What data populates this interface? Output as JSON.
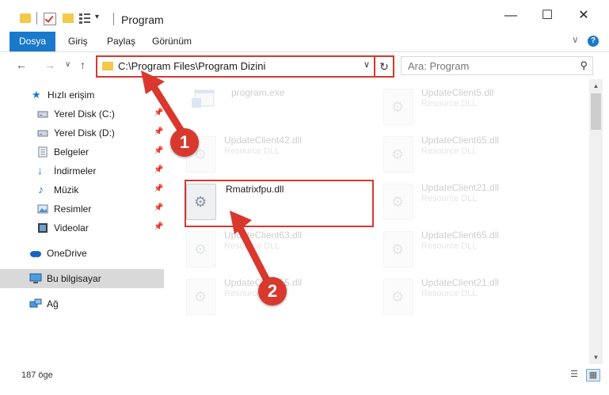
{
  "window": {
    "title": "Program",
    "minimize": "—",
    "maximize": "☐",
    "close": "✕"
  },
  "quick_access_toolbar": {
    "dropdown": "▾"
  },
  "ribbon": {
    "tabs": [
      "Dosya",
      "Giriş",
      "Paylaş",
      "Görünüm"
    ],
    "expand": "∨",
    "help": "?"
  },
  "navigation": {
    "back": "←",
    "forward": "→",
    "recent": "∨",
    "up": "↑",
    "address": "C:\\Program Files\\Program Dizini",
    "address_dropdown": "∨",
    "refresh": "↻",
    "search_placeholder": "Ara: Program",
    "search_icon": "⚲"
  },
  "sidebar": {
    "items": [
      {
        "label": "Hızlı erişim",
        "icon": "star-icon",
        "pinned": false
      },
      {
        "label": "Yerel Disk (C:)",
        "icon": "drive-icon",
        "pinned": true
      },
      {
        "label": "Yerel Disk (D:)",
        "icon": "drive-icon",
        "pinned": true
      },
      {
        "label": "Belgeler",
        "icon": "documents-icon",
        "pinned": true
      },
      {
        "label": "İndirmeler",
        "icon": "download-icon",
        "pinned": true
      },
      {
        "label": "Müzik",
        "icon": "music-icon",
        "pinned": true
      },
      {
        "label": "Resimler",
        "icon": "pictures-icon",
        "pinned": true
      },
      {
        "label": "Videolar",
        "icon": "video-icon",
        "pinned": true
      },
      {
        "label": "OneDrive",
        "icon": "cloud-icon",
        "pinned": false
      },
      {
        "label": "Bu bilgisayar",
        "icon": "computer-icon",
        "pinned": false,
        "selected": true
      },
      {
        "label": "Ağ",
        "icon": "network-icon",
        "pinned": false
      }
    ],
    "pin_glyph": "📌"
  },
  "files": [
    {
      "name": "program.exe",
      "type": "",
      "faded": true
    },
    {
      "name": "UpdateClient5.dll",
      "type": "Resource DLL",
      "faded": true
    },
    {
      "name": "UpdateClient42.dll",
      "type": "Resource DLL",
      "faded": true
    },
    {
      "name": "UpdateClient65.dll",
      "type": "Resource DLL",
      "faded": true
    },
    {
      "name": "Rmatrixfpu.dll",
      "type": "",
      "faded": false
    },
    {
      "name": "UpdateClient21.dll",
      "type": "Resource DLL",
      "faded": true
    },
    {
      "name": "UpdateClient63.dll",
      "type": "Resource DLL",
      "faded": true
    },
    {
      "name": "UpdateClient65.dll",
      "type": "Resource DLL",
      "faded": true
    },
    {
      "name": "UpdateClient55.dll",
      "type": "Resource DLL",
      "faded": true
    },
    {
      "name": "UpdateClient21.dll",
      "type": "Resource DLL",
      "faded": true
    }
  ],
  "annotations": {
    "badge_1": "1",
    "badge_2": "2"
  },
  "status": {
    "item_count": "187 öge"
  },
  "colors": {
    "accent": "#1979ca",
    "annotation": "#d9382e",
    "selected": "#d9d9d9"
  }
}
